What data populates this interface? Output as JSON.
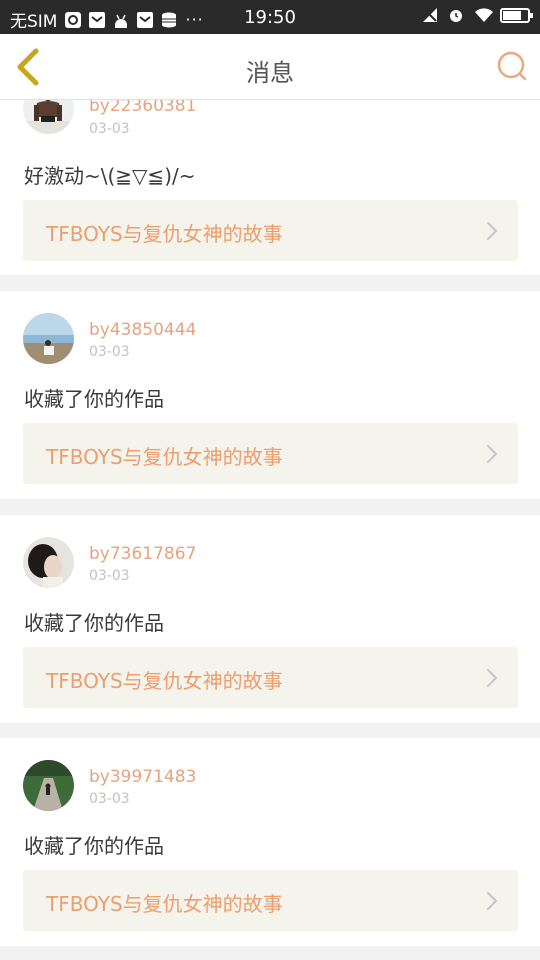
{
  "status_bar": {
    "carrier": "无SIM",
    "time": "19:50"
  },
  "header": {
    "title": "消息"
  },
  "messages": [
    {
      "username": "by22360381",
      "date": "03-03",
      "text": "好激动~\\(≧▽≦)/~",
      "work_title": "TFBOYS与复仇女神的故事"
    },
    {
      "username": "by43850444",
      "date": "03-03",
      "text": "收藏了你的作品",
      "work_title": "TFBOYS与复仇女神的故事"
    },
    {
      "username": "by73617867",
      "date": "03-03",
      "text": "收藏了你的作品",
      "work_title": "TFBOYS与复仇女神的故事"
    },
    {
      "username": "by39971483",
      "date": "03-03",
      "text": "收藏了你的作品",
      "work_title": "TFBOYS与复仇女神的故事"
    }
  ],
  "colors": {
    "accent": "#e8a37e",
    "back_arrow": "#c4a71c"
  }
}
